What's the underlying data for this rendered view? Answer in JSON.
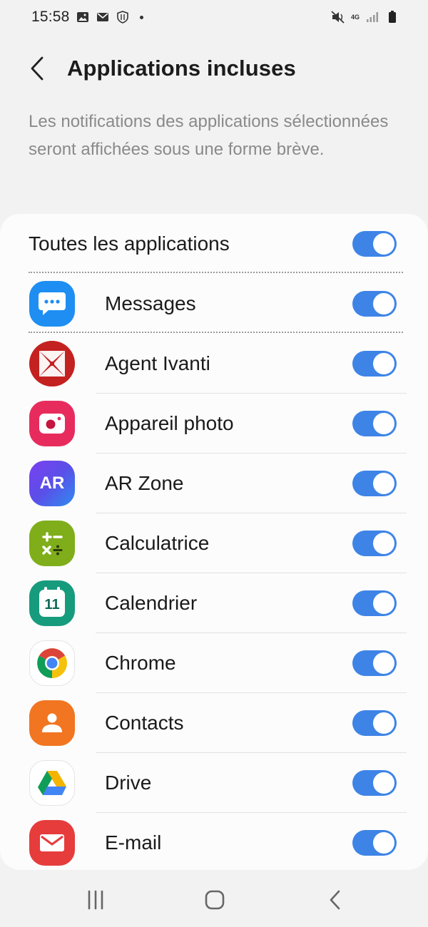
{
  "status_bar": {
    "time": "15:58",
    "network": "4G",
    "icons": [
      "gallery-icon",
      "mail-icon",
      "shield-icon",
      "dot-icon",
      "mute-icon",
      "signal-icon",
      "battery-icon"
    ]
  },
  "header": {
    "title": "Applications incluses",
    "back_icon": "chevron-left-icon"
  },
  "description": "Les notifications des applications sélectionnées seront affichées sous une forme brève.",
  "all_apps": {
    "label": "Toutes les applications",
    "enabled": true
  },
  "apps": [
    {
      "name": "Messages",
      "icon": "messages-icon",
      "enabled": true
    },
    {
      "name": "Agent Ivanti",
      "icon": "ivanti-icon",
      "enabled": true
    },
    {
      "name": "Appareil photo",
      "icon": "camera-icon",
      "enabled": true
    },
    {
      "name": "AR Zone",
      "icon": "ar-zone-icon",
      "icon_text": "AR",
      "enabled": true
    },
    {
      "name": "Calculatrice",
      "icon": "calculator-icon",
      "enabled": true
    },
    {
      "name": "Calendrier",
      "icon": "calendar-icon",
      "icon_text": "11",
      "enabled": true
    },
    {
      "name": "Chrome",
      "icon": "chrome-icon",
      "enabled": true
    },
    {
      "name": "Contacts",
      "icon": "contacts-icon",
      "enabled": true
    },
    {
      "name": "Drive",
      "icon": "drive-icon",
      "enabled": true
    },
    {
      "name": "E-mail",
      "icon": "email-icon",
      "enabled": true
    }
  ],
  "colors": {
    "toggle_on": "#3e84e7",
    "background": "#f2f2f2",
    "card": "#fcfcfc"
  },
  "nav_bar": {
    "icons": [
      "recents-icon",
      "home-icon",
      "back-icon"
    ]
  }
}
